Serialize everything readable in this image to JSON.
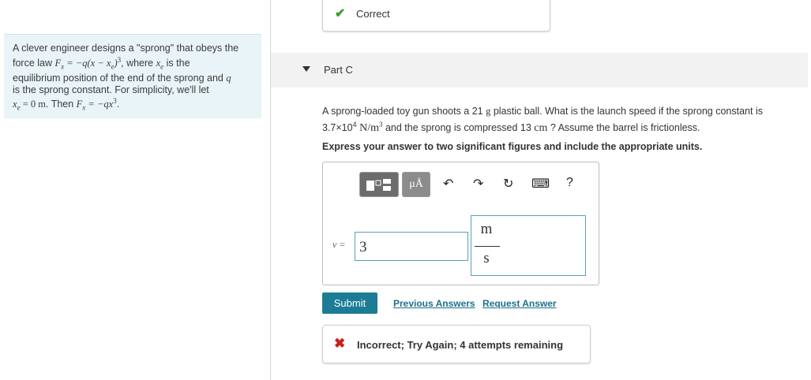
{
  "status_top": {
    "label": "Correct",
    "icon": "check-icon"
  },
  "problem": {
    "line1": "A clever engineer designs a \"sprong\" that obeys the",
    "line2_a": "force law ",
    "line2_math": "F",
    "line2_sub": "x",
    "line2_b": " = −q(x − x",
    "line2_sub2": "e",
    "line2_c": ")",
    "line2_sup": "3",
    "line2_d": ", where ",
    "line2_e": "x",
    "line2_sub3": "e",
    "line2_f": " is the",
    "line3": "equilibrium position of the end of the sprong and ",
    "line3_q": "q",
    "line4": "is the sprong constant. For simplicity, we'll let",
    "line5_a": "x",
    "line5_sub": "e",
    "line5_b": " = 0 m",
    "line5_c": ". Then ",
    "line5_d": "F",
    "line5_sub2": "x",
    "line5_e": " = −qx",
    "line5_sup": "3",
    "line5_f": "."
  },
  "part": {
    "label": "Part C",
    "caret": "caret-down-icon"
  },
  "question": {
    "text_a": "A sprong-loaded toy gun shoots a 21 ",
    "unit_g": "g",
    "text_b": " plastic ball. What is the launch speed if the sprong constant is",
    "text_c": "3.7×10",
    "exp4": "4",
    "unit_nm": " N/m",
    "exp3": "3",
    "text_d": " and the sprong is compressed 13 ",
    "unit_cm": "cm",
    "text_e": " ? Assume the barrel is frictionless."
  },
  "instruction": "Express your answer to two significant figures and include the appropriate units.",
  "toolbar": {
    "units_label": "μÅ",
    "undo": "↶",
    "redo": "↷",
    "reset": "↻",
    "keyboard": "⌨",
    "help": "?"
  },
  "answer": {
    "variable": "v =",
    "value": "3",
    "unit_numerator": "m",
    "unit_denominator": "s"
  },
  "actions": {
    "submit": "Submit",
    "previous_answers": "Previous Answers",
    "request_answer": "Request Answer"
  },
  "feedback": {
    "icon": "x-icon",
    "text": "Incorrect; Try Again; 4 attempts remaining"
  },
  "colors": {
    "accent": "#1c7c96",
    "correct": "#3e9a2a",
    "incorrect": "#c8201b",
    "problem_bg": "#e8f4f7"
  }
}
